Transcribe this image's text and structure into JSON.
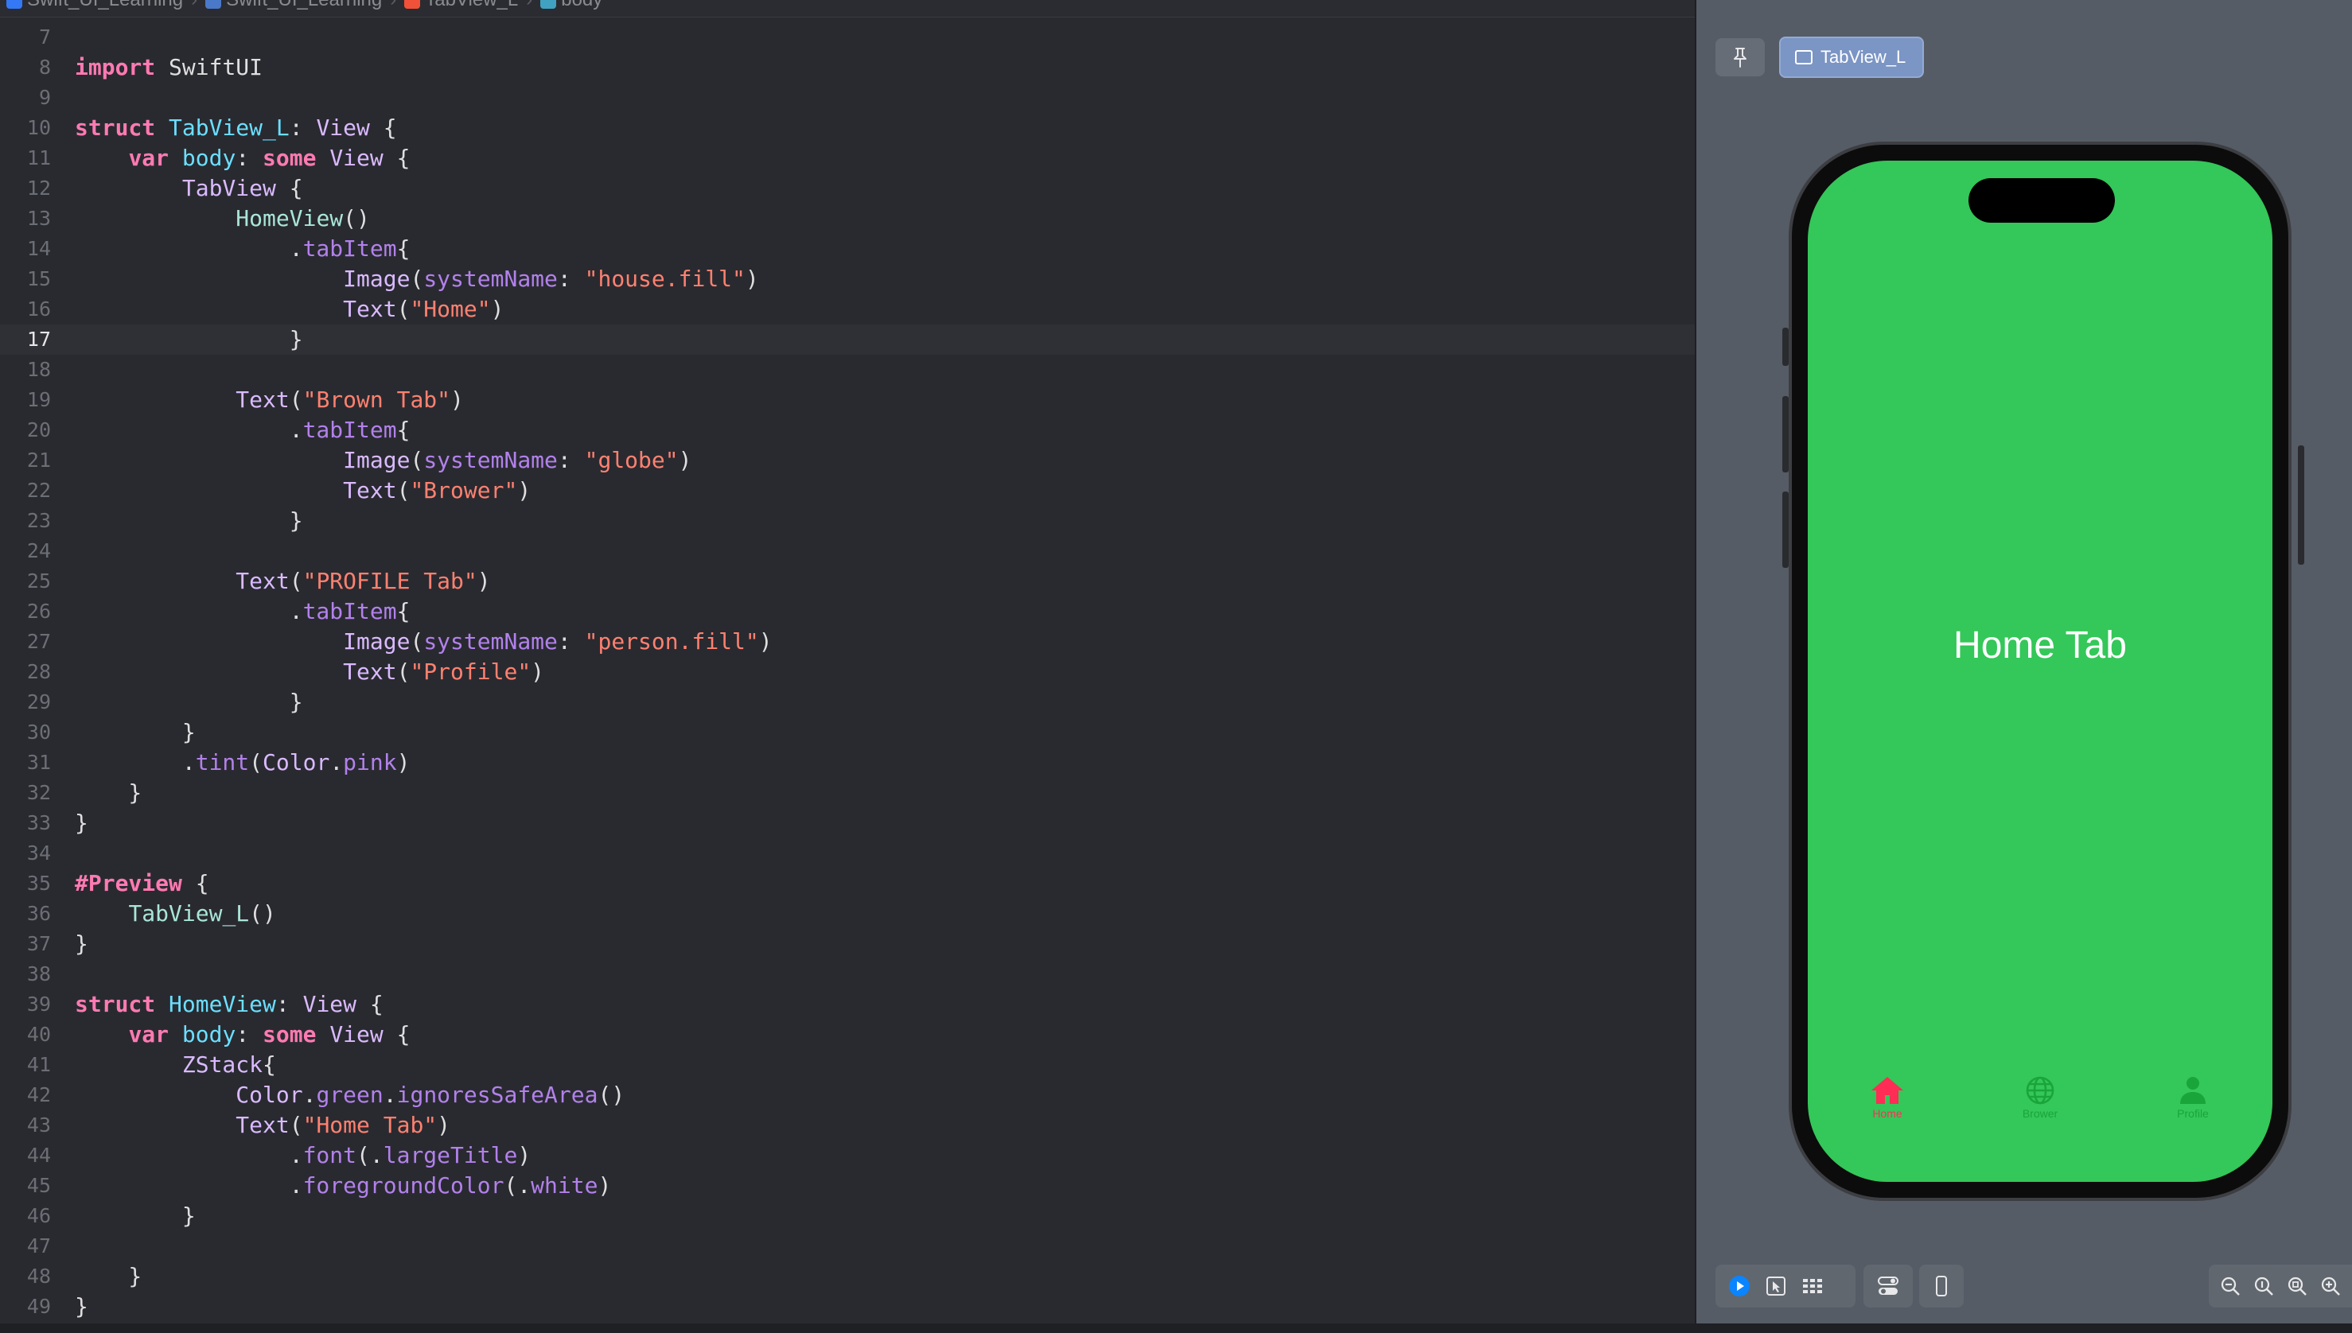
{
  "breadcrumb": {
    "items": [
      "Swift_UI_Learning",
      "Swift_UI_Learning",
      "TabView_L",
      "body"
    ]
  },
  "editor": {
    "current_line": 17,
    "lines": [
      {
        "n": "7",
        "tokens": []
      },
      {
        "n": "8",
        "tokens": [
          [
            "kw",
            "import"
          ],
          [
            "p",
            " SwiftUI"
          ]
        ]
      },
      {
        "n": "9",
        "tokens": []
      },
      {
        "n": "10",
        "tokens": [
          [
            "kw",
            "struct"
          ],
          [
            "p",
            " "
          ],
          [
            "tp",
            "TabView_L"
          ],
          [
            "p",
            ": "
          ],
          [
            "ty",
            "View"
          ],
          [
            "p",
            " {"
          ]
        ]
      },
      {
        "n": "11",
        "tokens": [
          [
            "p",
            "    "
          ],
          [
            "kw",
            "var"
          ],
          [
            "p",
            " "
          ],
          [
            "tp",
            "body"
          ],
          [
            "p",
            ": "
          ],
          [
            "kw",
            "some"
          ],
          [
            "p",
            " "
          ],
          [
            "ty",
            "View"
          ],
          [
            "p",
            " {"
          ]
        ]
      },
      {
        "n": "12",
        "tokens": [
          [
            "p",
            "        "
          ],
          [
            "ty",
            "TabView"
          ],
          [
            "p",
            " {"
          ]
        ]
      },
      {
        "n": "13",
        "tokens": [
          [
            "p",
            "            "
          ],
          [
            "fn",
            "HomeView"
          ],
          [
            "p",
            "()"
          ]
        ]
      },
      {
        "n": "14",
        "tokens": [
          [
            "p",
            "                ."
          ],
          [
            "pr",
            "tabItem"
          ],
          [
            "p",
            "{"
          ]
        ]
      },
      {
        "n": "15",
        "tokens": [
          [
            "p",
            "                    "
          ],
          [
            "ty",
            "Image"
          ],
          [
            "p",
            "("
          ],
          [
            "pr",
            "systemName"
          ],
          [
            "p",
            ": "
          ],
          [
            "st",
            "\"house.fill\""
          ],
          [
            "p",
            ")"
          ]
        ]
      },
      {
        "n": "16",
        "tokens": [
          [
            "p",
            "                    "
          ],
          [
            "ty",
            "Text"
          ],
          [
            "p",
            "("
          ],
          [
            "st",
            "\"Home\""
          ],
          [
            "p",
            ")"
          ]
        ]
      },
      {
        "n": "17",
        "tokens": [
          [
            "p",
            "                }"
          ]
        ]
      },
      {
        "n": "18",
        "tokens": []
      },
      {
        "n": "19",
        "tokens": [
          [
            "p",
            "            "
          ],
          [
            "ty",
            "Text"
          ],
          [
            "p",
            "("
          ],
          [
            "st",
            "\"Brown Tab\""
          ],
          [
            "p",
            ")"
          ]
        ]
      },
      {
        "n": "20",
        "tokens": [
          [
            "p",
            "                ."
          ],
          [
            "pr",
            "tabItem"
          ],
          [
            "p",
            "{"
          ]
        ]
      },
      {
        "n": "21",
        "tokens": [
          [
            "p",
            "                    "
          ],
          [
            "ty",
            "Image"
          ],
          [
            "p",
            "("
          ],
          [
            "pr",
            "systemName"
          ],
          [
            "p",
            ": "
          ],
          [
            "st",
            "\"globe\""
          ],
          [
            "p",
            ")"
          ]
        ]
      },
      {
        "n": "22",
        "tokens": [
          [
            "p",
            "                    "
          ],
          [
            "ty",
            "Text"
          ],
          [
            "p",
            "("
          ],
          [
            "st",
            "\"Brower\""
          ],
          [
            "p",
            ")"
          ]
        ]
      },
      {
        "n": "23",
        "tokens": [
          [
            "p",
            "                }"
          ]
        ]
      },
      {
        "n": "24",
        "tokens": []
      },
      {
        "n": "25",
        "tokens": [
          [
            "p",
            "            "
          ],
          [
            "ty",
            "Text"
          ],
          [
            "p",
            "("
          ],
          [
            "st",
            "\"PROFILE Tab\""
          ],
          [
            "p",
            ")"
          ]
        ]
      },
      {
        "n": "26",
        "tokens": [
          [
            "p",
            "                ."
          ],
          [
            "pr",
            "tabItem"
          ],
          [
            "p",
            "{"
          ]
        ]
      },
      {
        "n": "27",
        "tokens": [
          [
            "p",
            "                    "
          ],
          [
            "ty",
            "Image"
          ],
          [
            "p",
            "("
          ],
          [
            "pr",
            "systemName"
          ],
          [
            "p",
            ": "
          ],
          [
            "st",
            "\"person.fill\""
          ],
          [
            "p",
            ")"
          ]
        ]
      },
      {
        "n": "28",
        "tokens": [
          [
            "p",
            "                    "
          ],
          [
            "ty",
            "Text"
          ],
          [
            "p",
            "("
          ],
          [
            "st",
            "\"Profile\""
          ],
          [
            "p",
            ")"
          ]
        ]
      },
      {
        "n": "29",
        "tokens": [
          [
            "p",
            "                }"
          ]
        ]
      },
      {
        "n": "30",
        "tokens": [
          [
            "p",
            "        }"
          ]
        ]
      },
      {
        "n": "31",
        "tokens": [
          [
            "p",
            "        ."
          ],
          [
            "pr",
            "tint"
          ],
          [
            "p",
            "("
          ],
          [
            "ty",
            "Color"
          ],
          [
            "p",
            "."
          ],
          [
            "pr",
            "pink"
          ],
          [
            "p",
            ")"
          ]
        ]
      },
      {
        "n": "32",
        "tokens": [
          [
            "p",
            "    }"
          ]
        ]
      },
      {
        "n": "33",
        "tokens": [
          [
            "p",
            "}"
          ]
        ]
      },
      {
        "n": "34",
        "tokens": []
      },
      {
        "n": "35",
        "tokens": [
          [
            "kw",
            "#Preview"
          ],
          [
            "p",
            " {"
          ]
        ]
      },
      {
        "n": "36",
        "tokens": [
          [
            "p",
            "    "
          ],
          [
            "fn",
            "TabView_L"
          ],
          [
            "p",
            "()"
          ]
        ]
      },
      {
        "n": "37",
        "tokens": [
          [
            "p",
            "}"
          ]
        ]
      },
      {
        "n": "38",
        "tokens": []
      },
      {
        "n": "39",
        "tokens": [
          [
            "kw",
            "struct"
          ],
          [
            "p",
            " "
          ],
          [
            "tp",
            "HomeView"
          ],
          [
            "p",
            ": "
          ],
          [
            "ty",
            "View"
          ],
          [
            "p",
            " {"
          ]
        ]
      },
      {
        "n": "40",
        "tokens": [
          [
            "p",
            "    "
          ],
          [
            "kw",
            "var"
          ],
          [
            "p",
            " "
          ],
          [
            "tp",
            "body"
          ],
          [
            "p",
            ": "
          ],
          [
            "kw",
            "some"
          ],
          [
            "p",
            " "
          ],
          [
            "ty",
            "View"
          ],
          [
            "p",
            " {"
          ]
        ]
      },
      {
        "n": "41",
        "tokens": [
          [
            "p",
            "        "
          ],
          [
            "ty",
            "ZStack"
          ],
          [
            "p",
            "{"
          ]
        ]
      },
      {
        "n": "42",
        "tokens": [
          [
            "p",
            "            "
          ],
          [
            "ty",
            "Color"
          ],
          [
            "p",
            "."
          ],
          [
            "pr",
            "green"
          ],
          [
            "p",
            "."
          ],
          [
            "pr",
            "ignoresSafeArea"
          ],
          [
            "p",
            "()"
          ]
        ]
      },
      {
        "n": "43",
        "tokens": [
          [
            "p",
            "            "
          ],
          [
            "ty",
            "Text"
          ],
          [
            "p",
            "("
          ],
          [
            "st",
            "\"Home Tab\""
          ],
          [
            "p",
            ")"
          ]
        ]
      },
      {
        "n": "44",
        "tokens": [
          [
            "p",
            "                ."
          ],
          [
            "pr",
            "font"
          ],
          [
            "p",
            "(."
          ],
          [
            "pr",
            "largeTitle"
          ],
          [
            "p",
            ")"
          ]
        ]
      },
      {
        "n": "45",
        "tokens": [
          [
            "p",
            "                ."
          ],
          [
            "pr",
            "foregroundColor"
          ],
          [
            "p",
            "(."
          ],
          [
            "pr",
            "white"
          ],
          [
            "p",
            ")"
          ]
        ]
      },
      {
        "n": "46",
        "tokens": [
          [
            "p",
            "        }"
          ]
        ]
      },
      {
        "n": "47",
        "tokens": []
      },
      {
        "n": "48",
        "tokens": [
          [
            "p",
            "    }"
          ]
        ]
      },
      {
        "n": "49",
        "tokens": [
          [
            "p",
            "}"
          ]
        ]
      }
    ]
  },
  "preview": {
    "tab_label": "TabView_L",
    "screen_title": "Home Tab",
    "tabs": [
      {
        "label": "Home",
        "icon": "house-fill-icon",
        "color": "#ff2d55"
      },
      {
        "label": "Brower",
        "icon": "globe-icon",
        "color": "#1aa53a"
      },
      {
        "label": "Profile",
        "icon": "person-fill-icon",
        "color": "#1aa53a"
      }
    ]
  },
  "colors": {
    "editor_bg": "#292a30",
    "canvas_bg": "#555c66",
    "screen_green": "#34c759",
    "tint_pink": "#ff2d55"
  }
}
